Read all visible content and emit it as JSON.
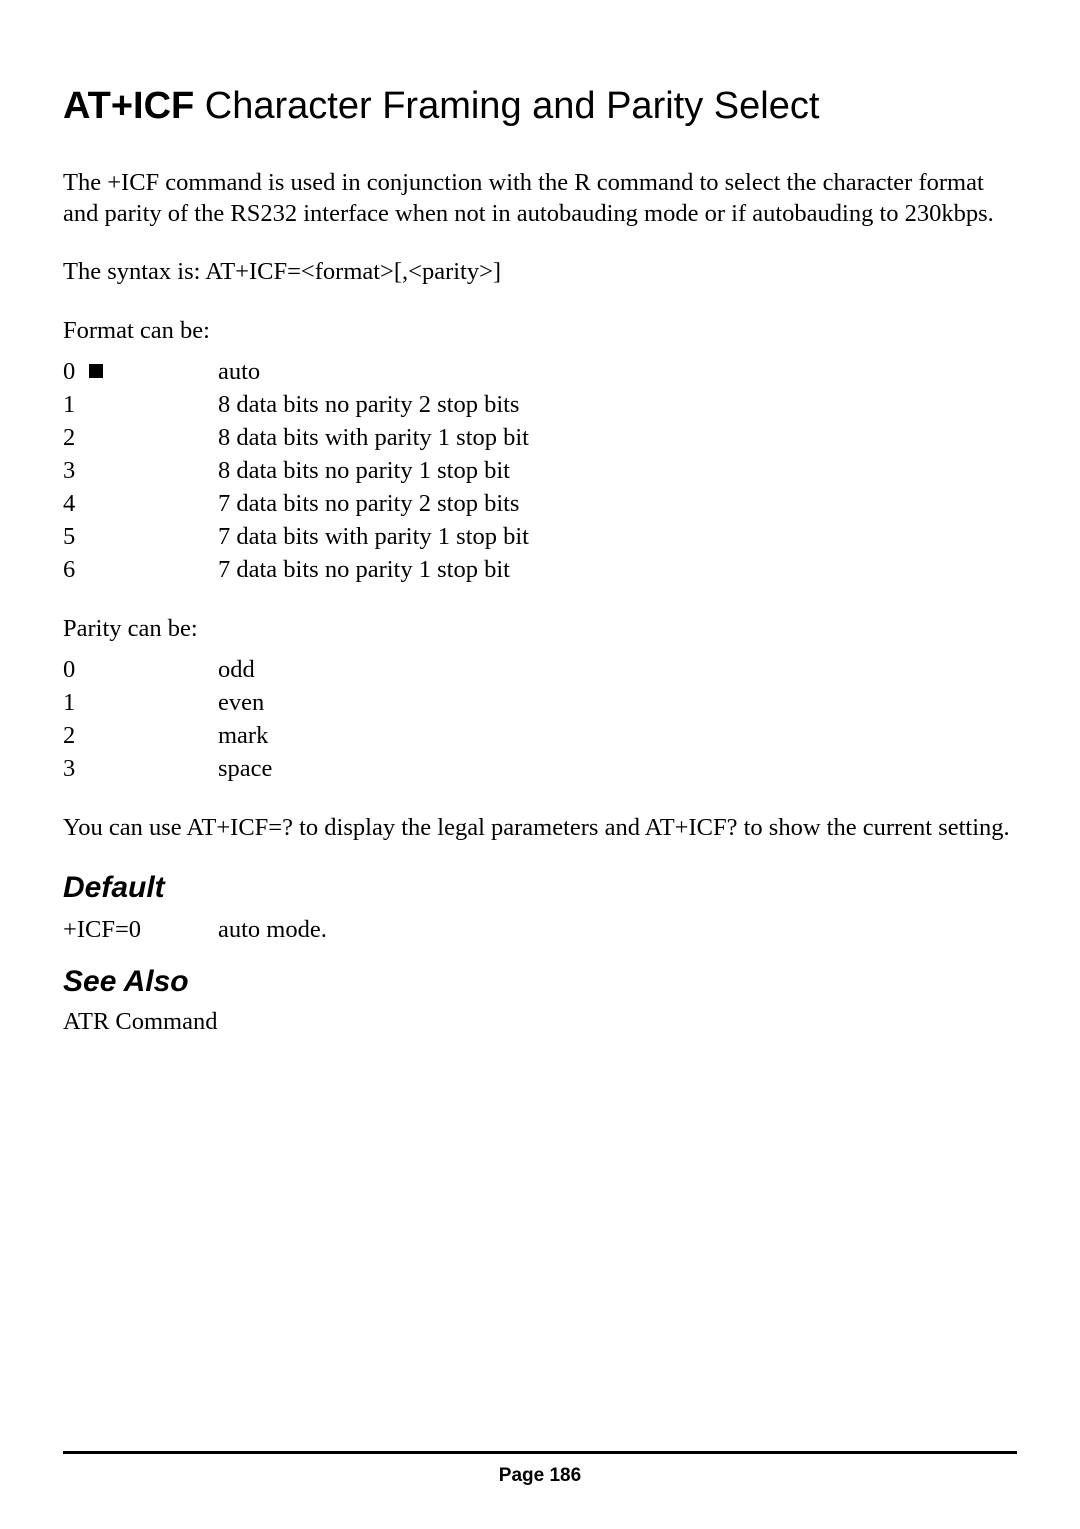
{
  "title": {
    "cmd": "AT+ICF",
    "rest": " Character Framing and Parity Select"
  },
  "intro": "The +ICF command is used in conjunction with the R command to select the character format and parity of the RS232 interface when not in autobauding mode or if autobauding to 230kbps.",
  "syntax": "The syntax is: AT+ICF=<format>[,<parity>]",
  "format_lead": "Format can be:",
  "format_rows": [
    {
      "code": "0",
      "has_bullet": true,
      "desc": "auto"
    },
    {
      "code": "1",
      "has_bullet": false,
      "desc": "8 data bits no parity 2 stop bits"
    },
    {
      "code": "2",
      "has_bullet": false,
      "desc": "8 data bits with parity 1 stop bit"
    },
    {
      "code": "3",
      "has_bullet": false,
      "desc": "8 data bits no parity 1 stop bit"
    },
    {
      "code": "4",
      "has_bullet": false,
      "desc": "7 data bits no parity 2 stop bits"
    },
    {
      "code": "5",
      "has_bullet": false,
      "desc": "7 data bits with parity 1 stop bit"
    },
    {
      "code": "6",
      "has_bullet": false,
      "desc": "7 data bits no parity 1 stop bit"
    }
  ],
  "parity_lead": "Parity can be:",
  "parity_rows": [
    {
      "code": "0",
      "desc": "odd"
    },
    {
      "code": "1",
      "desc": "even"
    },
    {
      "code": "2",
      "desc": "mark"
    },
    {
      "code": "3",
      "desc": "space"
    }
  ],
  "usage": "You can use AT+ICF=? to display the legal parameters and AT+ICF? to show the current setting.",
  "default_heading": "Default",
  "default_row": {
    "code": "+ICF=0",
    "desc": "auto mode."
  },
  "see_also_heading": "See Also",
  "see_also_text": "ATR Command",
  "footer": "Page 186"
}
